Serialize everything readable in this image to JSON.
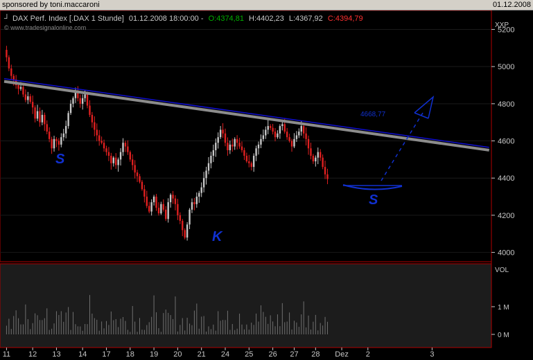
{
  "topbar": {
    "sponsor": "sponsored by toni.maccaroni",
    "date": "01.12.2008"
  },
  "header": {
    "name": "DAX Perf. Index [.DAX  1 Stunde]",
    "datetime": "01.12.2008 18:00:00 -",
    "open": "O:4374,81",
    "high": "H:4402,23",
    "low": "L:4367,92",
    "close": "C:4394,79",
    "watermark": "© www.tradesignalonline.com",
    "currency": "XXP"
  },
  "colors": {
    "bull": "#c8c8c8",
    "bear": "#e02020",
    "trend": "#1010d0",
    "grey_trend": "#8c8c8c",
    "annotation": "#1030d0",
    "panel_border": "#c00000",
    "open_green": "#00b000",
    "close_red": "#ff3030"
  },
  "chart_data": {
    "type": "candlestick",
    "ylim": [
      3950,
      5280
    ],
    "yticks": [
      4000,
      4200,
      4400,
      4600,
      4800,
      5000,
      5200
    ],
    "ytick_labels": [
      "4000",
      "4200",
      "4400",
      "4600",
      "4800",
      "5000",
      "5200"
    ],
    "x_tick_labels": [
      {
        "label": "11",
        "i": 1
      },
      {
        "label": "12",
        "i": 12
      },
      {
        "label": "13",
        "i": 22
      },
      {
        "label": "14",
        "i": 33
      },
      {
        "label": "17",
        "i": 43
      },
      {
        "label": "18",
        "i": 53
      },
      {
        "label": "19",
        "i": 63
      },
      {
        "label": "20",
        "i": 73
      },
      {
        "label": "21",
        "i": 83
      },
      {
        "label": "24",
        "i": 93
      },
      {
        "label": "25",
        "i": 103
      },
      {
        "label": "26",
        "i": 113
      },
      {
        "label": "27",
        "i": 122
      },
      {
        "label": "28",
        "i": 131
      },
      {
        "label": "Dez",
        "i": 142
      },
      {
        "label": "2",
        "i": 153
      },
      {
        "label": "3",
        "i": 180
      }
    ],
    "prices": [
      5090,
      5050,
      4990,
      4950,
      4930,
      4900,
      4880,
      4890,
      4850,
      4820,
      4840,
      4810,
      4780,
      4720,
      4760,
      4700,
      4740,
      4690,
      4650,
      4610,
      4560,
      4610,
      4600,
      4580,
      4620,
      4640,
      4680,
      4750,
      4800,
      4830,
      4860,
      4830,
      4800,
      4830,
      4850,
      4790,
      4740,
      4700,
      4660,
      4630,
      4600,
      4590,
      4560,
      4540,
      4520,
      4480,
      4510,
      4470,
      4500,
      4540,
      4590,
      4570,
      4540,
      4500,
      4470,
      4430,
      4410,
      4380,
      4340,
      4300,
      4250,
      4220,
      4270,
      4300,
      4240,
      4210,
      4260,
      4230,
      4180,
      4270,
      4310,
      4290,
      4260,
      4200,
      4170,
      4120,
      4080,
      4150,
      4230,
      4270,
      4260,
      4300,
      4320,
      4350,
      4400,
      4440,
      4480,
      4520,
      4550,
      4590,
      4620,
      4660,
      4640,
      4590,
      4550,
      4580,
      4570,
      4610,
      4590,
      4570,
      4550,
      4520,
      4490,
      4480,
      4460,
      4520,
      4560,
      4580,
      4610,
      4630,
      4660,
      4680,
      4670,
      4650,
      4620,
      4640,
      4680,
      4690,
      4650,
      4620,
      4600,
      4570,
      4610,
      4630,
      4650,
      4680,
      4640,
      4610,
      4560,
      4520,
      4490,
      4510,
      4540,
      4510,
      4460,
      4420,
      4395
    ],
    "trendline_blue": {
      "x1": 0,
      "y1": 4935,
      "x2": 204,
      "y2": 4565,
      "label": "4668,77"
    },
    "trendline_grey": {
      "x1": 0,
      "y1": 4920,
      "x2": 204,
      "y2": 4550
    },
    "volume_ticks": [
      "VOL",
      "1 M",
      "0 M"
    ],
    "annotations": [
      "S",
      "K",
      "S"
    ]
  }
}
